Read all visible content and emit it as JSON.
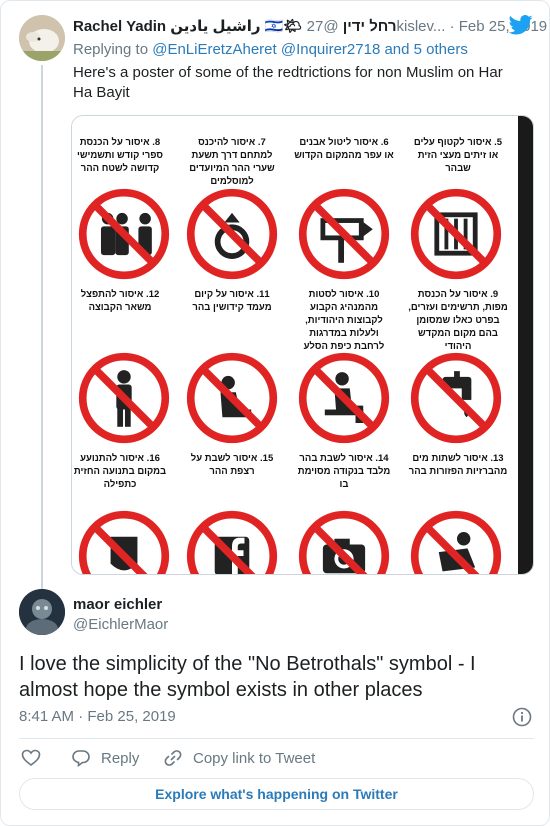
{
  "reply_tweet": {
    "author_name": "Rachel Yadin راشيل يادين 🇮🇱🌤 רחל ידין",
    "handle": "@27kislev...",
    "separator": "·",
    "date": "Feb 25, 2019",
    "replying_prefix": "Replying to",
    "replying_to": "@EnLiEretzAheret @Inquirer2718",
    "replying_suffix": "and 5 others",
    "text": "Here's a poster of some of the redtrictions for non Muslim on Har Ha Bayit",
    "poster": {
      "captions_row1": [
        "5. איסור לקטוף עלים או זיתים מעצי הזית שבהר",
        "6. איסור ליטול אבנים או עפר מהמקום הקדוש",
        "7. איסור להיכנס למתחם דרך תשעת שערי ההר המיועדים למוסלמים",
        "8. איסור על הכנסת ספרי קודש ותשמישי קדושה לשטח ההר"
      ],
      "captions_row2": [
        "9. איסור על הכנסת מפות, תרשימים ועזרים, בפרט כאלו שמסומן בהם מקום המקדש היהודי",
        "10. איסור לסטות מהמנהיג הקבוע לקבוצות היהודיות, ולעלות במדרגות לרחבת כיפת הסלע",
        "11. איסור על קיום מעמד קידושין בהר",
        "12. איסור להתפצל משאר הקבוצה"
      ],
      "captions_row3": [
        "13. איסור לשתות מים מהברזיות הפזורות בהר",
        "14. איסור לשבת בהר מלבד בנקודה מסוימת בו",
        "15. איסור לשבת על רצפת ההר",
        "16. איסור להתנועע במקום בתנועה החזית כתפילה"
      ]
    }
  },
  "main_tweet": {
    "author_name": "maor eichler",
    "handle": "@EichlerMaor",
    "text": "I love the simplicity of the \"No Betrothals\" symbol - I almost hope the symbol exists in other places",
    "timestamp": "8:41 AM · Feb 25, 2019"
  },
  "actions": {
    "reply_label": "Reply",
    "copy_link_label": "Copy link to Tweet"
  },
  "explore_label": "Explore what's happening on Twitter",
  "colors": {
    "link": "#2b7bb9",
    "muted": "#697882",
    "sign_red": "#e02424",
    "twitter_blue": "#1da1f2"
  }
}
